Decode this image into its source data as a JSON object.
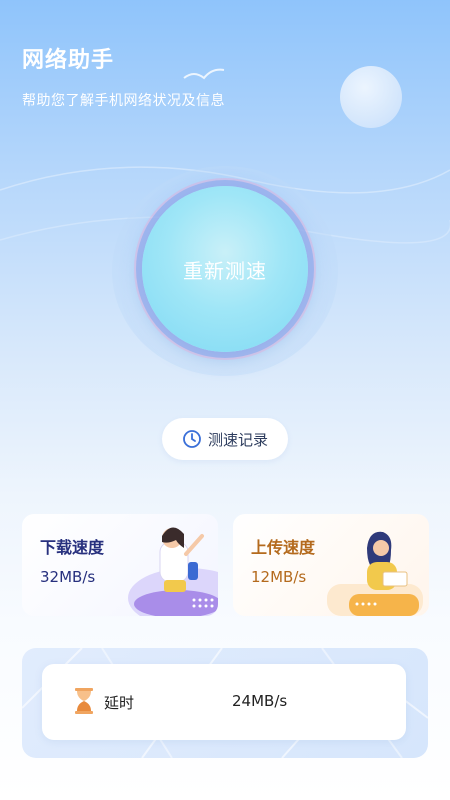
{
  "header": {
    "title": "网络助手",
    "subtitle": "帮助您了解手机网络状况及信息"
  },
  "main": {
    "retest_label": "重新测速",
    "record_label": "测速记录"
  },
  "cards": {
    "download": {
      "title": "下载速度",
      "value": "32MB/s"
    },
    "upload": {
      "title": "上传速度",
      "value": "12MB/s"
    }
  },
  "latency": {
    "label": "延时",
    "value": "24MB/s"
  },
  "colors": {
    "accent": "#3a6fd8",
    "download_text": "#27307e",
    "upload_text": "#b46a1d"
  },
  "icons": {
    "record": "clock-icon",
    "latency": "hourglass-icon"
  }
}
